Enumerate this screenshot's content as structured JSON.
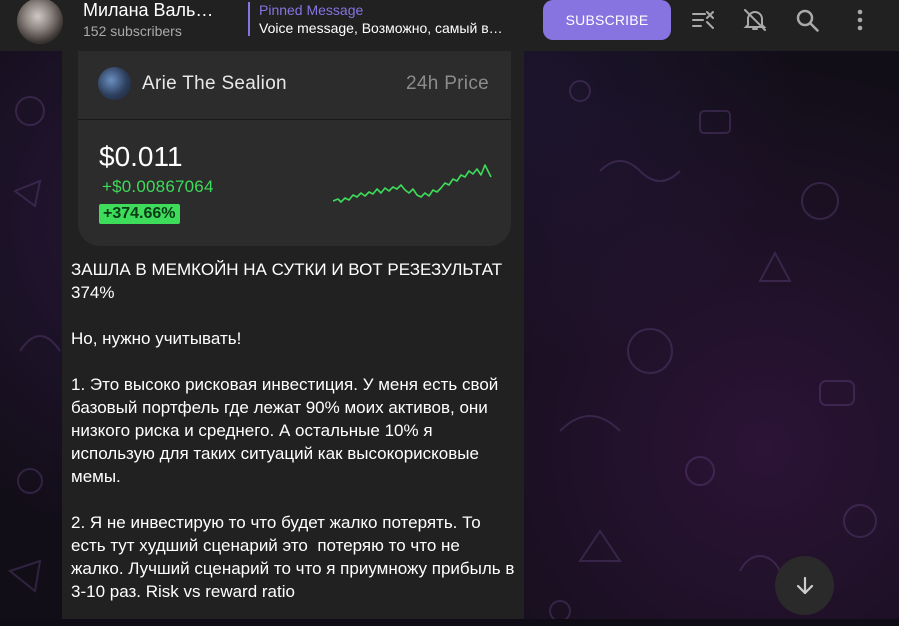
{
  "header": {
    "title": "Милана Валь…",
    "subscribers": "152 subscribers",
    "pinned_title": "Pinned Message",
    "pinned_text": "Voice message, Возможно, самый в…",
    "subscribe_label": "SUBSCRIBE",
    "icons": [
      "livestream-icon",
      "mute-icon",
      "search-icon",
      "more-icon"
    ]
  },
  "card": {
    "token_name": "Arie The Sealion",
    "price_label": "24h Price",
    "price": "$0.011",
    "delta": "+$0.00867064",
    "percent": "+374.66%",
    "accent": "#3ddc5a"
  },
  "message": {
    "paragraphs": [
      "ЗАШЛА В МЕМКОЙН НА СУТКИ И ВОТ РЕЗЕЗУЛЬТАТ 374%",
      "Но, нужно учитывать!",
      "1. Это высоко рисковая инвестиция. У меня есть свой базовый портфель где лежат 90% моих активов, они низкого риска и среднего. А остальные 10% я использую для таких ситуаций как высокорисковые мемы.",
      "2. Я не инвестирую то что будет жалко потерять. То есть тут худший сценарий это  потеряю то что не жалко. Лучший сценарий то что я приумножу прибыль в 3-10 раз. Risk vs reward ratio"
    ]
  },
  "colors": {
    "accent": "#8774e1",
    "header_bg": "#212121"
  }
}
